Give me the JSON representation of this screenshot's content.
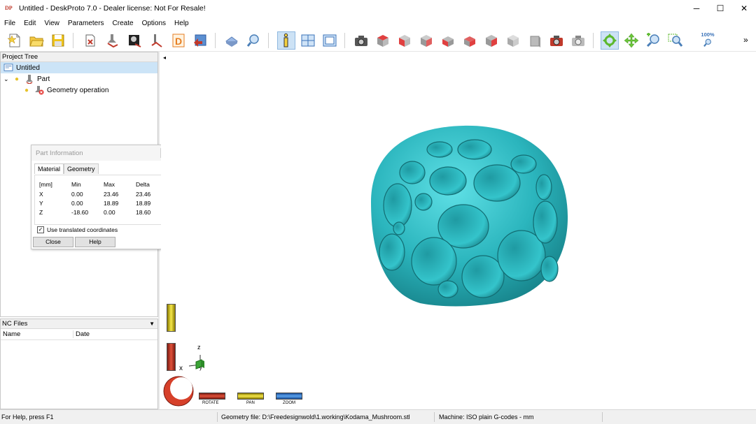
{
  "window": {
    "title": "Untitled - DeskProto 7.0 - Dealer license: Not For Resale!",
    "logo": "DP"
  },
  "menu": [
    "File",
    "Edit",
    "View",
    "Parameters",
    "Create",
    "Options",
    "Help"
  ],
  "toolbar": {
    "zoom_label": "100%",
    "overflow": "»"
  },
  "project_tree": {
    "header": "Project Tree",
    "items": [
      {
        "label": "Untitled",
        "icon": "project-icon"
      },
      {
        "label": "Part",
        "icon": "part-icon"
      },
      {
        "label": "Geometry operation",
        "icon": "geometry-operation-icon"
      }
    ]
  },
  "nc_files": {
    "header": "NC Files",
    "columns": [
      "Name",
      "Date"
    ]
  },
  "part_info": {
    "title": "Part Information",
    "tabs": [
      "Material",
      "Geometry"
    ],
    "headers": [
      "[mm]",
      "Min",
      "Max",
      "Delta"
    ],
    "rows": [
      [
        "X",
        "0.00",
        "23.46",
        "23.46"
      ],
      [
        "Y",
        "0.00",
        "18.89",
        "18.89"
      ],
      [
        "Z",
        "-18.60",
        "0.00",
        "18.60"
      ]
    ],
    "checkbox_label": "Use translated coordinates",
    "checkbox_checked": true,
    "close_label": "Close",
    "help_label": "Help"
  },
  "viewport": {
    "model_color": "#2bb5bd",
    "axis_labels": {
      "x": "x",
      "y": "y",
      "z": "z"
    },
    "controls": {
      "rotate": "ROTATE",
      "pan": "PAN",
      "zoom": "ZOOM"
    },
    "collapse_arrow": "◂"
  },
  "status": {
    "help": "For Help, press F1",
    "geometry_file": "Geometry file: D:\\Freedesignwold\\1.working\\Kodama_Mushroom.stl",
    "machine": "Machine: ISO plain G-codes - mm"
  }
}
